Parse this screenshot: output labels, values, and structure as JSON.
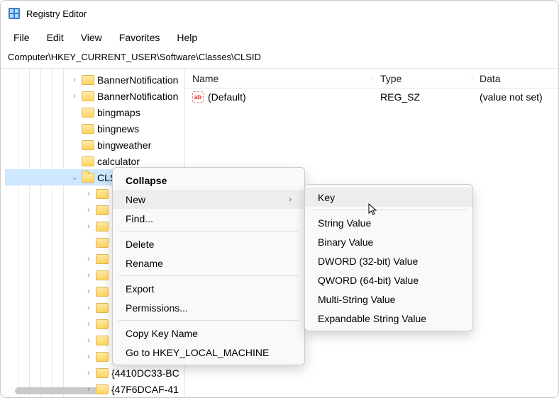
{
  "title": "Registry Editor",
  "menubar": [
    "File",
    "Edit",
    "View",
    "Favorites",
    "Help"
  ],
  "address": "Computer\\HKEY_CURRENT_USER\\Software\\Classes\\CLSID",
  "tree": {
    "items": [
      {
        "label": "BannerNotification",
        "twisty": ">",
        "indent": 92,
        "open": false
      },
      {
        "label": "BannerNotification",
        "twisty": ">",
        "indent": 92,
        "open": false
      },
      {
        "label": "bingmaps",
        "twisty": "",
        "indent": 92,
        "open": false
      },
      {
        "label": "bingnews",
        "twisty": "",
        "indent": 92,
        "open": false
      },
      {
        "label": "bingweather",
        "twisty": "",
        "indent": 92,
        "open": false
      },
      {
        "label": "calculator",
        "twisty": "",
        "indent": 92,
        "open": false
      },
      {
        "label": "CLSID",
        "twisty": "v",
        "indent": 92,
        "open": true,
        "sel": true
      },
      {
        "label": "",
        "twisty": ">",
        "indent": 112,
        "open": false
      },
      {
        "label": "",
        "twisty": ">",
        "indent": 112,
        "open": false
      },
      {
        "label": "",
        "twisty": ">",
        "indent": 112,
        "open": false
      },
      {
        "label": "",
        "twisty": "",
        "indent": 112,
        "open": false
      },
      {
        "label": "",
        "twisty": ">",
        "indent": 112,
        "open": false
      },
      {
        "label": "",
        "twisty": ">",
        "indent": 112,
        "open": false
      },
      {
        "label": "",
        "twisty": ">",
        "indent": 112,
        "open": false
      },
      {
        "label": "",
        "twisty": ">",
        "indent": 112,
        "open": false
      },
      {
        "label": "",
        "twisty": ">",
        "indent": 112,
        "open": false
      },
      {
        "label": "",
        "twisty": ">",
        "indent": 112,
        "open": false
      },
      {
        "label": "",
        "twisty": ">",
        "indent": 112,
        "open": false
      },
      {
        "label": "{4410DC33-BC",
        "twisty": ">",
        "indent": 112,
        "open": false
      },
      {
        "label": "{47F6DCAF-41",
        "twisty": ">",
        "indent": 112,
        "open": false
      }
    ]
  },
  "columns": {
    "name": "Name",
    "type": "Type",
    "data": "Data",
    "w_name": 265,
    "w_type": 140
  },
  "rows": [
    {
      "name": "(Default)",
      "type": "REG_SZ",
      "data": "(value not set)"
    }
  ],
  "context_main": {
    "items": [
      {
        "label": "Collapse",
        "bold": true
      },
      {
        "label": "New",
        "submenu": true,
        "highlight": true
      },
      {
        "label": "Find..."
      },
      {
        "sep": true
      },
      {
        "label": "Delete"
      },
      {
        "label": "Rename"
      },
      {
        "sep": true
      },
      {
        "label": "Export"
      },
      {
        "label": "Permissions..."
      },
      {
        "sep": true
      },
      {
        "label": "Copy Key Name"
      },
      {
        "label": "Go to HKEY_LOCAL_MACHINE"
      }
    ]
  },
  "context_sub": {
    "items": [
      {
        "label": "Key",
        "highlight": true
      },
      {
        "sep": true
      },
      {
        "label": "String Value"
      },
      {
        "label": "Binary Value"
      },
      {
        "label": "DWORD (32-bit) Value"
      },
      {
        "label": "QWORD (64-bit) Value"
      },
      {
        "label": "Multi-String Value"
      },
      {
        "label": "Expandable String Value"
      }
    ]
  }
}
